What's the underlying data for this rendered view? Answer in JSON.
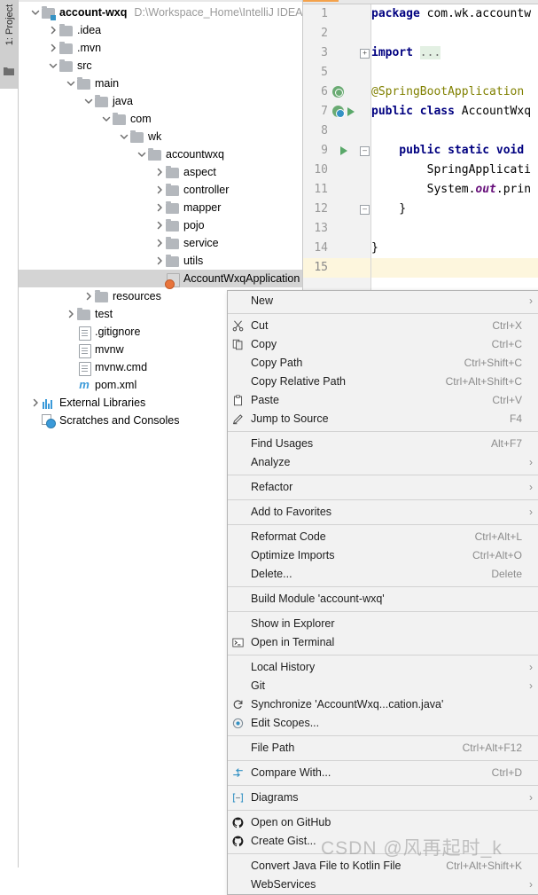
{
  "ide": {
    "left_tool_strip": {
      "project_tab_label": "1: Project",
      "project_tab_mnemonic": "1",
      "structure_icon": "folder-icon"
    }
  },
  "project_tree": {
    "items": [
      {
        "depth": 0,
        "twisty": "expanded",
        "icon": "module-folder-icon",
        "label": "account-wxq",
        "bold": true,
        "path": "D:\\Workspace_Home\\IntelliJ IDEA",
        "selected": false
      },
      {
        "depth": 1,
        "twisty": "collapsed",
        "icon": "folder-icon",
        "label": ".idea",
        "bold": false,
        "path": "",
        "selected": false
      },
      {
        "depth": 1,
        "twisty": "collapsed",
        "icon": "folder-icon",
        "label": ".mvn",
        "bold": false,
        "path": "",
        "selected": false
      },
      {
        "depth": 1,
        "twisty": "expanded",
        "icon": "folder-icon",
        "label": "src",
        "bold": false,
        "path": "",
        "selected": false
      },
      {
        "depth": 2,
        "twisty": "expanded",
        "icon": "folder-icon",
        "label": "main",
        "bold": false,
        "path": "",
        "selected": false
      },
      {
        "depth": 3,
        "twisty": "expanded",
        "icon": "folder-icon",
        "label": "java",
        "bold": false,
        "path": "",
        "selected": false
      },
      {
        "depth": 4,
        "twisty": "expanded",
        "icon": "folder-icon",
        "label": "com",
        "bold": false,
        "path": "",
        "selected": false
      },
      {
        "depth": 5,
        "twisty": "expanded",
        "icon": "folder-icon",
        "label": "wk",
        "bold": false,
        "path": "",
        "selected": false
      },
      {
        "depth": 6,
        "twisty": "expanded",
        "icon": "folder-icon",
        "label": "accountwxq",
        "bold": false,
        "path": "",
        "selected": false
      },
      {
        "depth": 7,
        "twisty": "collapsed",
        "icon": "folder-icon",
        "label": "aspect",
        "bold": false,
        "path": "",
        "selected": false
      },
      {
        "depth": 7,
        "twisty": "collapsed",
        "icon": "folder-icon",
        "label": "controller",
        "bold": false,
        "path": "",
        "selected": false
      },
      {
        "depth": 7,
        "twisty": "collapsed",
        "icon": "folder-icon",
        "label": "mapper",
        "bold": false,
        "path": "",
        "selected": false
      },
      {
        "depth": 7,
        "twisty": "collapsed",
        "icon": "folder-icon",
        "label": "pojo",
        "bold": false,
        "path": "",
        "selected": false
      },
      {
        "depth": 7,
        "twisty": "collapsed",
        "icon": "folder-icon",
        "label": "service",
        "bold": false,
        "path": "",
        "selected": false
      },
      {
        "depth": 7,
        "twisty": "collapsed",
        "icon": "folder-icon",
        "label": "utils",
        "bold": false,
        "path": "",
        "selected": false
      },
      {
        "depth": 7,
        "twisty": "none",
        "icon": "java-class-icon",
        "label": "AccountWxqApplication",
        "bold": false,
        "path": "",
        "selected": true
      },
      {
        "depth": 3,
        "twisty": "collapsed",
        "icon": "folder-icon",
        "label": "resources",
        "bold": false,
        "path": "",
        "selected": false
      },
      {
        "depth": 2,
        "twisty": "collapsed",
        "icon": "folder-icon",
        "label": "test",
        "bold": false,
        "path": "",
        "selected": false
      },
      {
        "depth": 2,
        "twisty": "none",
        "icon": "text-file-icon",
        "label": ".gitignore",
        "bold": false,
        "path": "",
        "selected": false
      },
      {
        "depth": 2,
        "twisty": "none",
        "icon": "text-file-icon",
        "label": "mvnw",
        "bold": false,
        "path": "",
        "selected": false
      },
      {
        "depth": 2,
        "twisty": "none",
        "icon": "text-file-icon",
        "label": "mvnw.cmd",
        "bold": false,
        "path": "",
        "selected": false
      },
      {
        "depth": 2,
        "twisty": "none",
        "icon": "maven-icon",
        "label": "pom.xml",
        "bold": false,
        "path": "",
        "selected": false
      },
      {
        "depth": 0,
        "twisty": "collapsed",
        "icon": "external-libraries-icon",
        "label": "External Libraries",
        "bold": false,
        "path": "",
        "selected": false
      },
      {
        "depth": 0,
        "twisty": "none",
        "icon": "scratches-icon",
        "label": "Scratches and Consoles",
        "bold": false,
        "path": "",
        "selected": false
      }
    ]
  },
  "editor": {
    "lines": [
      {
        "num": "1",
        "tokens": [
          {
            "t": "package ",
            "c": "kw"
          },
          {
            "t": "com.wk.accountw",
            "c": "plain"
          }
        ],
        "gutter": "",
        "fold": "",
        "highlight": false
      },
      {
        "num": "2",
        "tokens": [],
        "gutter": "",
        "fold": "",
        "highlight": false
      },
      {
        "num": "3",
        "tokens": [
          {
            "t": "import ",
            "c": "kw"
          },
          {
            "t": "...",
            "c": "folded"
          }
        ],
        "gutter": "",
        "fold": "plus",
        "highlight": false
      },
      {
        "num": "5",
        "tokens": [],
        "gutter": "",
        "fold": "",
        "highlight": false
      },
      {
        "num": "6",
        "tokens": [
          {
            "t": "@SpringBootApplication",
            "c": "anno"
          }
        ],
        "gutter": "bean",
        "fold": "",
        "highlight": false
      },
      {
        "num": "7",
        "tokens": [
          {
            "t": "public class ",
            "c": "kw"
          },
          {
            "t": "AccountWxq",
            "c": "plain"
          }
        ],
        "gutter": "spring-run",
        "fold": "",
        "highlight": false
      },
      {
        "num": "8",
        "tokens": [],
        "gutter": "",
        "fold": "",
        "highlight": false
      },
      {
        "num": "9",
        "tokens": [
          {
            "t": "    public static void ",
            "c": "kw"
          }
        ],
        "gutter": "run",
        "fold": "minus",
        "highlight": false
      },
      {
        "num": "10",
        "tokens": [
          {
            "t": "        SpringApplicati",
            "c": "plain"
          }
        ],
        "gutter": "",
        "fold": "",
        "highlight": false
      },
      {
        "num": "11",
        "tokens": [
          {
            "t": "        System.",
            "c": "plain"
          },
          {
            "t": "out",
            "c": "fieldit"
          },
          {
            "t": ".prin",
            "c": "plain"
          }
        ],
        "gutter": "",
        "fold": "",
        "highlight": false
      },
      {
        "num": "12",
        "tokens": [
          {
            "t": "    }",
            "c": "plain"
          }
        ],
        "gutter": "",
        "fold": "minus",
        "highlight": false
      },
      {
        "num": "13",
        "tokens": [],
        "gutter": "",
        "fold": "",
        "highlight": false
      },
      {
        "num": "14",
        "tokens": [
          {
            "t": "}",
            "c": "plain"
          }
        ],
        "gutter": "",
        "fold": "",
        "highlight": false
      },
      {
        "num": "15",
        "tokens": [],
        "gutter": "",
        "fold": "",
        "highlight": true
      }
    ]
  },
  "context_menu": {
    "groups": [
      {
        "items": [
          {
            "icon": "",
            "label": "New",
            "shortcut": "",
            "submenu": true
          }
        ]
      },
      {
        "items": [
          {
            "icon": "scissors-icon",
            "label": "Cut",
            "mnemonic": "t",
            "shortcut": "Ctrl+X",
            "submenu": false
          },
          {
            "icon": "copy-icon",
            "label": "Copy",
            "mnemonic": "C",
            "shortcut": "Ctrl+C",
            "submenu": false
          },
          {
            "icon": "",
            "label": "Copy Path",
            "mnemonic": "o",
            "shortcut": "Ctrl+Shift+C",
            "submenu": false
          },
          {
            "icon": "",
            "label": "Copy Relative Path",
            "mnemonic": "y",
            "shortcut": "Ctrl+Alt+Shift+C",
            "submenu": false
          },
          {
            "icon": "paste-icon",
            "label": "Paste",
            "mnemonic": "P",
            "shortcut": "Ctrl+V",
            "submenu": false
          },
          {
            "icon": "pencil-icon",
            "label": "Jump to Source",
            "mnemonic": "",
            "shortcut": "F4",
            "submenu": false
          }
        ]
      },
      {
        "items": [
          {
            "icon": "",
            "label": "Find Usages",
            "mnemonic": "U",
            "shortcut": "Alt+F7",
            "submenu": false
          },
          {
            "icon": "",
            "label": "Analyze",
            "mnemonic": "z",
            "shortcut": "",
            "submenu": true
          }
        ]
      },
      {
        "items": [
          {
            "icon": "",
            "label": "Refactor",
            "mnemonic": "R",
            "shortcut": "",
            "submenu": true
          }
        ]
      },
      {
        "items": [
          {
            "icon": "",
            "label": "Add to Favorites",
            "mnemonic": "a",
            "shortcut": "",
            "submenu": true
          }
        ]
      },
      {
        "items": [
          {
            "icon": "",
            "label": "Reformat Code",
            "mnemonic": "R",
            "shortcut": "Ctrl+Alt+L",
            "submenu": false
          },
          {
            "icon": "",
            "label": "Optimize Imports",
            "mnemonic": "z",
            "shortcut": "Ctrl+Alt+O",
            "submenu": false
          },
          {
            "icon": "",
            "label": "Delete...",
            "mnemonic": "D",
            "shortcut": "Delete",
            "submenu": false
          }
        ]
      },
      {
        "items": [
          {
            "icon": "",
            "label": "Build Module 'account-wxq'",
            "mnemonic": "M",
            "shortcut": "",
            "submenu": false
          }
        ]
      },
      {
        "items": [
          {
            "icon": "",
            "label": "Show in Explorer",
            "mnemonic": "",
            "shortcut": "",
            "submenu": false
          },
          {
            "icon": "terminal-icon",
            "label": "Open in Terminal",
            "mnemonic": "",
            "shortcut": "",
            "submenu": false
          }
        ]
      },
      {
        "items": [
          {
            "icon": "",
            "label": "Local History",
            "mnemonic": "H",
            "shortcut": "",
            "submenu": true
          },
          {
            "icon": "",
            "label": "Git",
            "mnemonic": "G",
            "shortcut": "",
            "submenu": true
          },
          {
            "icon": "sync-icon",
            "label": "Synchronize 'AccountWxq...cation.java'",
            "mnemonic": "",
            "shortcut": "",
            "submenu": false
          },
          {
            "icon": "scope-icon",
            "label": "Edit Scopes...",
            "mnemonic": "i",
            "shortcut": "",
            "submenu": false
          }
        ]
      },
      {
        "items": [
          {
            "icon": "",
            "label": "File Path",
            "mnemonic": "P",
            "shortcut": "Ctrl+Alt+F12",
            "submenu": false
          }
        ]
      },
      {
        "items": [
          {
            "icon": "compare-icon",
            "label": "Compare With...",
            "mnemonic": "",
            "shortcut": "Ctrl+D",
            "submenu": false
          }
        ]
      },
      {
        "items": [
          {
            "icon": "diagram-icon",
            "label": "Diagrams",
            "mnemonic": "r",
            "shortcut": "",
            "submenu": true
          }
        ]
      },
      {
        "items": [
          {
            "icon": "github-icon",
            "label": "Open on GitHub",
            "mnemonic": "",
            "shortcut": "",
            "submenu": false
          },
          {
            "icon": "github-icon",
            "label": "Create Gist...",
            "mnemonic": "",
            "shortcut": "",
            "submenu": false
          }
        ]
      },
      {
        "items": [
          {
            "icon": "",
            "label": "Convert Java File to Kotlin File",
            "mnemonic": "",
            "shortcut": "Ctrl+Alt+Shift+K",
            "submenu": false
          },
          {
            "icon": "",
            "label": "WebServices",
            "mnemonic": "",
            "shortcut": "",
            "submenu": true
          }
        ]
      }
    ]
  },
  "watermark": {
    "text": "CSDN @风再起时_k"
  },
  "colors": {
    "menu_bg": "#f2f2f2",
    "menu_border": "#b5b5b5",
    "selection_bg": "#d4d4d4",
    "shortcut_text": "#8c8c8c",
    "tree_path_text": "#9a9a9a",
    "keyword": "#000080",
    "annotation": "#808000",
    "current_line": "#fdf6dd",
    "folder_icon": "#b4b8bd",
    "accent_blue": "#3592c4",
    "run_green": "#59a869"
  }
}
